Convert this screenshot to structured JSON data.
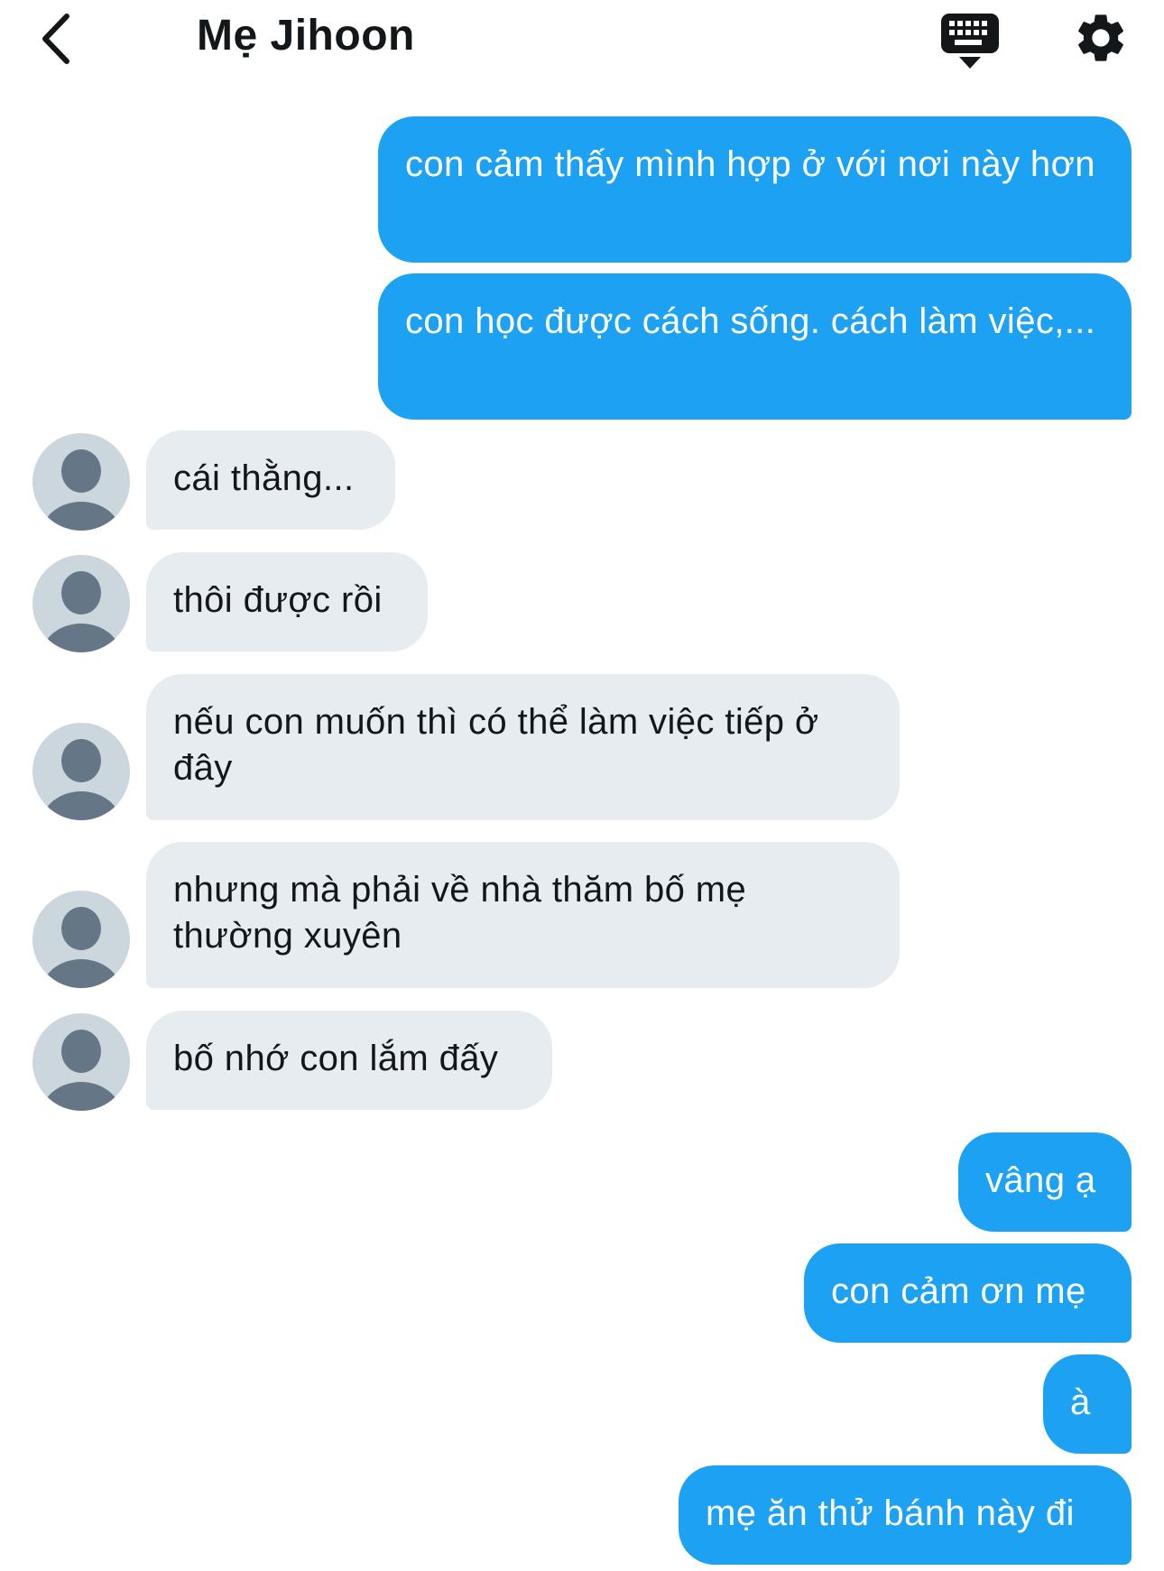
{
  "header": {
    "title": "Mẹ Jihoon"
  },
  "icons": {
    "back": "chevron-left-icon",
    "keyboard": "keyboard-icon",
    "settings": "gear-icon",
    "avatar": "default-avatar-icon"
  },
  "colors": {
    "outgoing_bubble": "#1da1f2",
    "incoming_bubble": "#e6ecf0",
    "avatar_bg": "#ccd6dd",
    "avatar_figure": "#657786",
    "text_dark": "#14171a"
  },
  "messages": [
    {
      "direction": "outgoing",
      "text": "con cảm thấy mình hợp ở với nơi này hơn"
    },
    {
      "direction": "outgoing",
      "text": "con học được cách sống. cách làm việc,..."
    },
    {
      "direction": "incoming",
      "text": "cái thằng..."
    },
    {
      "direction": "incoming",
      "text": "thôi được rồi"
    },
    {
      "direction": "incoming",
      "text": "nếu con muốn thì có thể làm việc tiếp ở đây"
    },
    {
      "direction": "incoming",
      "text": "nhưng mà phải về nhà thăm bố mẹ thường xuyên"
    },
    {
      "direction": "incoming",
      "text": "bố nhớ con lắm đấy"
    },
    {
      "direction": "outgoing",
      "text": "vâng ạ"
    },
    {
      "direction": "outgoing",
      "text": "con cảm ơn mẹ"
    },
    {
      "direction": "outgoing",
      "text": "à"
    },
    {
      "direction": "outgoing",
      "text": "mẹ ăn thử bánh này đi"
    }
  ]
}
